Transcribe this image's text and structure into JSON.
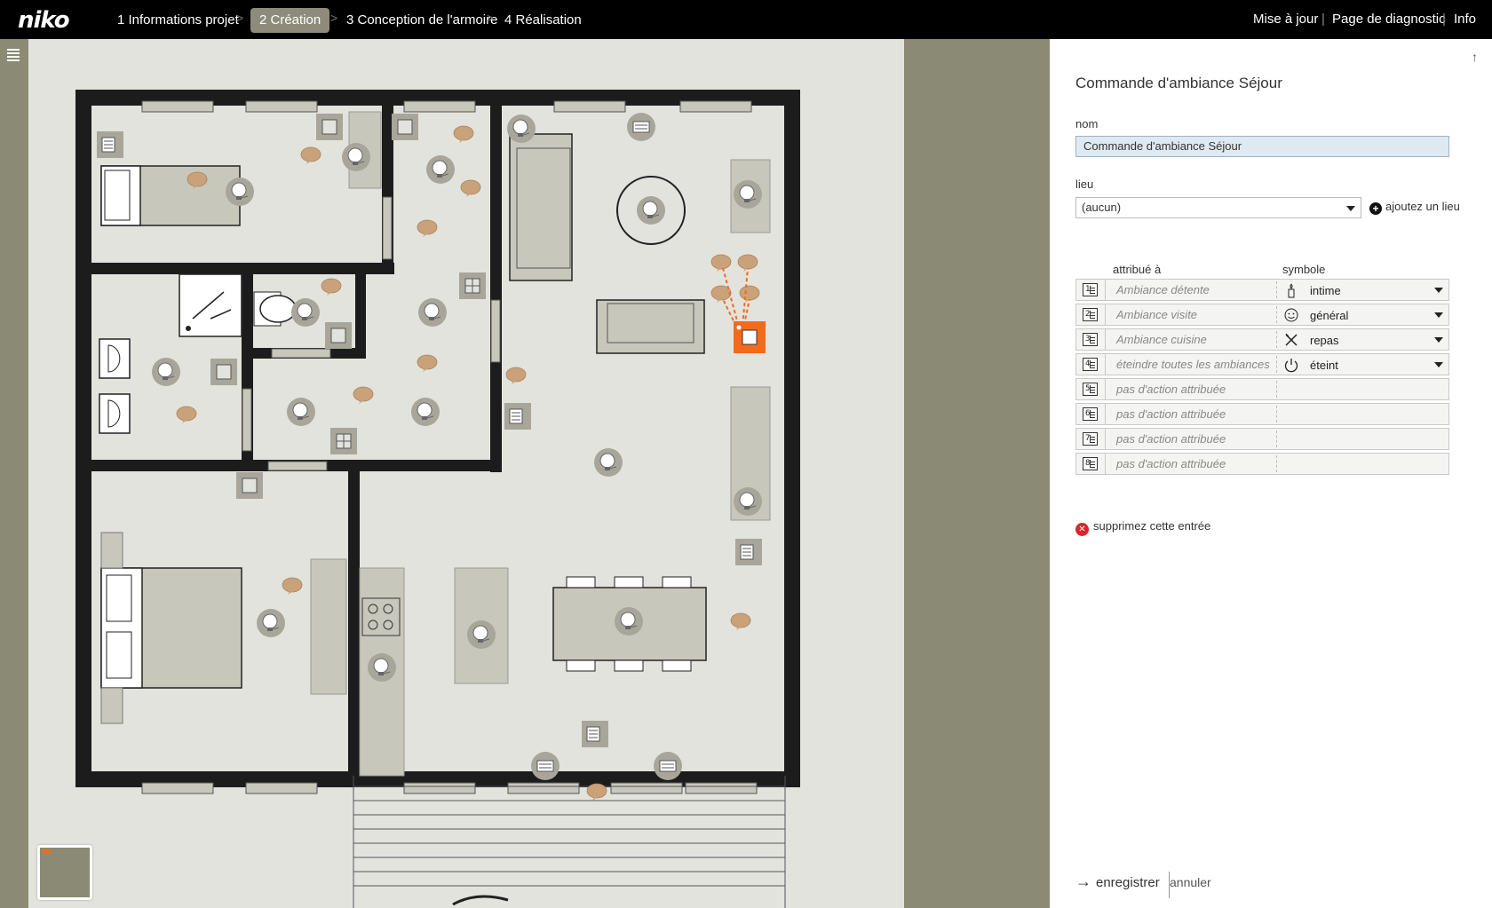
{
  "header": {
    "logo": "niko",
    "steps": [
      "1 Informations projet",
      "2 Création",
      "3 Conception de l'armoire",
      "4 Réalisation"
    ],
    "active_step": "2 Création",
    "nav": [
      "Mise à jour",
      "Page de diagnostic",
      "Info"
    ]
  },
  "panel": {
    "title": "Commande d'ambiance Séjour",
    "name_label": "nom",
    "name_value": "Commande d'ambiance Séjour",
    "lieu_label": "lieu",
    "lieu_value": "(aucun)",
    "add_lieu": "ajoutez un lieu",
    "col_assigned": "attribué à",
    "col_symbol": "symbole",
    "rows": [
      {
        "num": "1",
        "action": "Ambiance détente",
        "symbol": "intime",
        "icon": "candle-icon"
      },
      {
        "num": "2",
        "action": "Ambiance visite",
        "symbol": "général",
        "icon": "smiley-icon"
      },
      {
        "num": "3",
        "action": "Ambiance cuisine",
        "symbol": "repas",
        "icon": "cutlery-icon"
      },
      {
        "num": "4",
        "action": "éteindre toutes les ambiances",
        "symbol": "éteint",
        "icon": "power-icon"
      },
      {
        "num": "5",
        "action": "pas d'action attribuée",
        "symbol": "",
        "icon": ""
      },
      {
        "num": "6",
        "action": "pas d'action attribuée",
        "symbol": "",
        "icon": ""
      },
      {
        "num": "7",
        "action": "pas d'action attribuée",
        "symbol": "",
        "icon": ""
      },
      {
        "num": "8",
        "action": "pas d'action attribuée",
        "symbol": "",
        "icon": ""
      }
    ],
    "delete_entry": "supprimez cette entrée",
    "save": "enregistrer",
    "cancel": "annuler"
  },
  "colors": {
    "accent": "#f26b1d",
    "topbar": "#000000",
    "sidebar": "#8b8a74",
    "canvas": "#e3e3de",
    "wall": "#1c1c1c",
    "device": "#a8a69a",
    "speech": "#c9a27a"
  }
}
